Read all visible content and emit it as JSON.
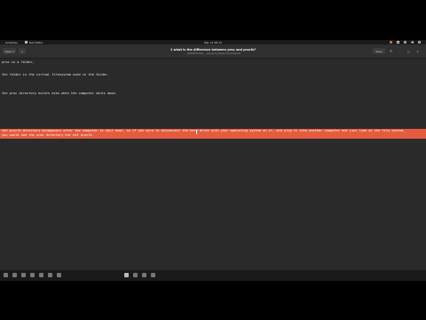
{
  "topbar": {
    "activities": "Activities",
    "app_name": "Text Editor",
    "clock": "Mar 12  08:15"
  },
  "toolbar": {
    "open_label": "Open",
    "new_tab_label": "+",
    "save_label": "Save",
    "title": "1 what is the difference between proc and procfs?",
    "subtitle": "~/SPECIFIC-DIR_...someone_file/procfs-folder.txt"
  },
  "editor": {
    "lines": [
      "proc is a folder,",
      "",
      "the folder is the virtual filesystem used in the folder.",
      "",
      "",
      "the proc directory exists even when the computer shuts down.",
      "",
      "",
      "the procfs directory disappears after the computer is shut down, so if you were to disconnect the hard drive with your operating system on it, and plug it into another computer and just look at the file system,",
      "you would see the proc directory but not procfs."
    ]
  },
  "colors": {
    "selection": "#e55b3f",
    "background": "#2a2a2a"
  }
}
